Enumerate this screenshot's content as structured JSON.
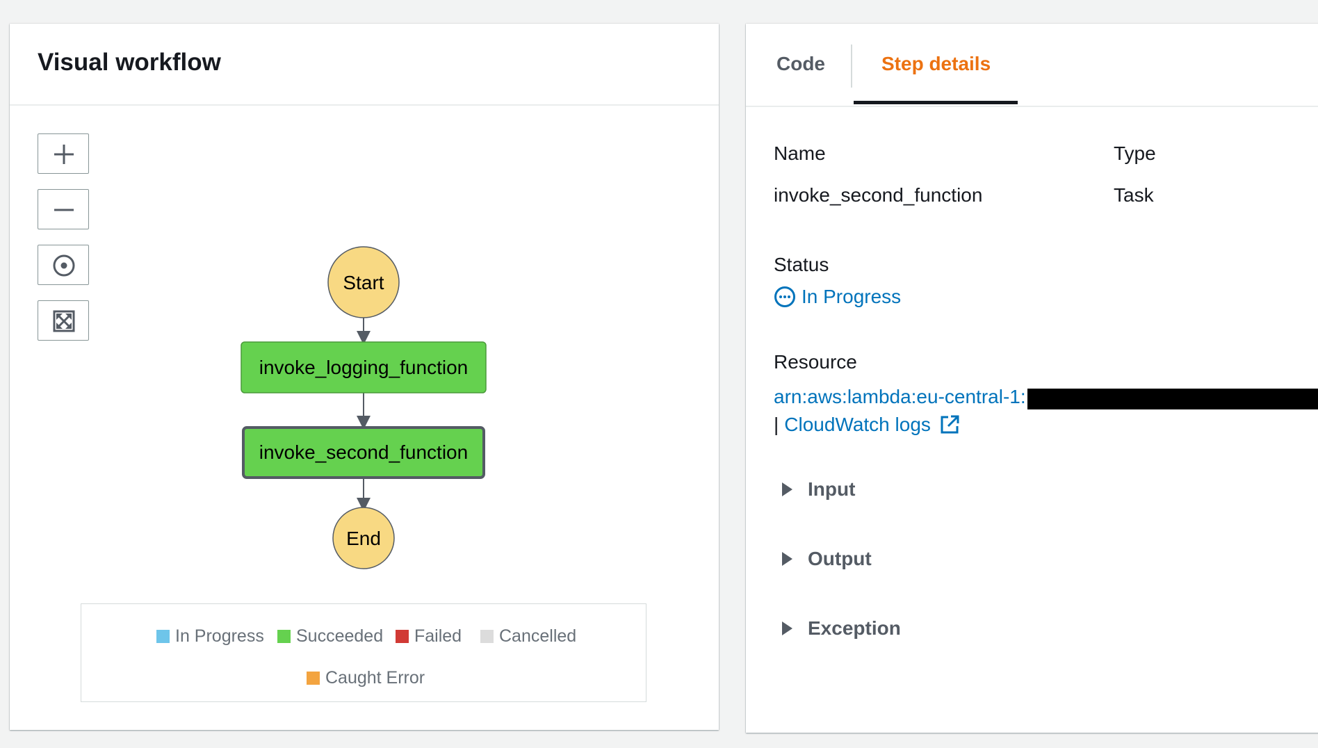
{
  "left": {
    "title": "Visual workflow",
    "zoom_buttons": [
      "zoom-in",
      "zoom-out",
      "center",
      "fit-to-screen"
    ],
    "nodes": {
      "start": "Start",
      "logging": "invoke_logging_function",
      "second": "invoke_second_function",
      "end": "End"
    },
    "colors": {
      "state_circle": "#f8d983",
      "succeeded": "#65d14f",
      "in_progress": "#6ec5ea",
      "failed": "#d13a35",
      "cancelled": "#dcdcdc",
      "caught_error": "#f3a440"
    },
    "legend": {
      "in_progress": "In Progress",
      "succeeded": "Succeeded",
      "failed": "Failed",
      "cancelled": "Cancelled",
      "caught_error": "Caught Error"
    }
  },
  "right": {
    "tabs": {
      "code": "Code",
      "step_details": "Step details"
    },
    "name_label": "Name",
    "name_value": "invoke_second_function",
    "type_label": "Type",
    "type_value": "Task",
    "status_label": "Status",
    "status_value": "In Progress",
    "resource_label": "Resource",
    "resource_arn": "arn:aws:lambda:eu-central-1:",
    "resource_sep": "|",
    "cloudwatch_link": "CloudWatch logs",
    "expanders": {
      "input": "Input",
      "output": "Output",
      "exception": "Exception"
    }
  }
}
